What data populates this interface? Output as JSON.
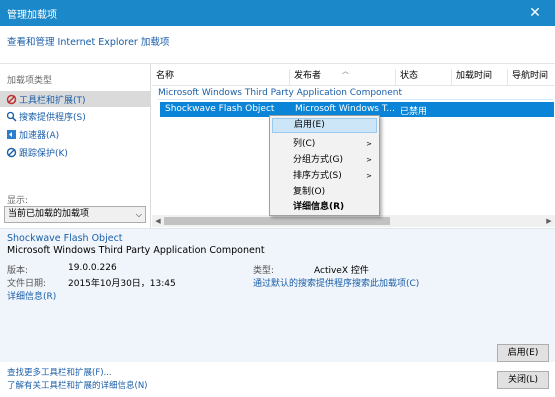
{
  "window": {
    "title": "管理加载项",
    "close_glyph": "✕"
  },
  "header": {
    "link": "查看和管理 Internet Explorer 加载项"
  },
  "sidebar": {
    "types_label": "加载项类型",
    "items": [
      {
        "label": "工具栏和扩展(T)",
        "icon": "gear-icon",
        "selected": true
      },
      {
        "label": "搜索提供程序(S)",
        "icon": "search-icon",
        "selected": false
      },
      {
        "label": "加速器(A)",
        "icon": "accelerator-icon",
        "selected": false
      },
      {
        "label": "跟踪保护(K)",
        "icon": "block-icon",
        "selected": false
      }
    ],
    "show_label": "显示:",
    "show_value": "当前已加载的加载项"
  },
  "list": {
    "columns": [
      "名称",
      "发布者",
      "状态",
      "加载时间",
      "导航时间"
    ],
    "group_name": "Microsoft Windows Third Party Application Component",
    "rows": [
      {
        "name": "Shockwave Flash Object",
        "publisher": "Microsoft Windows T...",
        "status": "已禁用"
      }
    ]
  },
  "context_menu": {
    "items": [
      {
        "label": "启用(E)",
        "submenu": false,
        "bold": false,
        "highlighted": true
      },
      {
        "label": "列(C)",
        "submenu": true,
        "bold": false,
        "highlighted": false
      },
      {
        "label": "分组方式(G)",
        "submenu": true,
        "bold": false,
        "highlighted": false
      },
      {
        "label": "排序方式(S)",
        "submenu": true,
        "bold": false,
        "highlighted": false
      },
      {
        "label": "复制(O)",
        "submenu": false,
        "bold": false,
        "highlighted": false
      },
      {
        "label": "详细信息(R)",
        "submenu": false,
        "bold": true,
        "highlighted": false
      }
    ]
  },
  "details": {
    "name": "Shockwave Flash Object",
    "publisher": "Microsoft Windows Third Party Application Component",
    "version_label": "版本:",
    "version": "19.0.0.226",
    "date_label": "文件日期:",
    "date": "2015年10月30日，13:45",
    "more_info_link": "详细信息(R)",
    "type_label": "类型:",
    "type": "ActiveX 控件",
    "search_link": "通过默认的搜索提供程序搜索此加载项(C)",
    "enable_button": "启用(E)"
  },
  "footer": {
    "link1": "查找更多工具栏和扩展(F)...",
    "link2": "了解有关工具栏和扩展的详细信息(N)",
    "close_button": "关闭(L)"
  },
  "colors": {
    "titlebar": "#1a88c9",
    "selection": "#0a84d7",
    "link": "#1a5ea8"
  }
}
